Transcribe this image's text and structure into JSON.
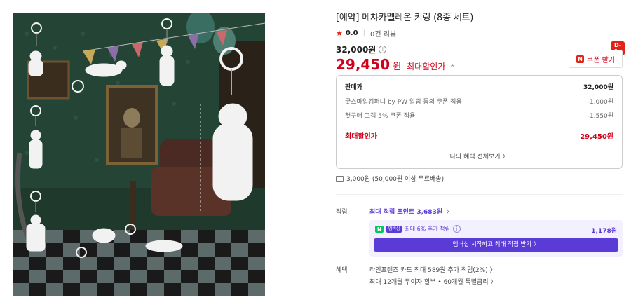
{
  "product": {
    "title": "[예약] 메챠카멜레온 키링 (8종 세트)",
    "rating_star": "★",
    "rating": "0.0",
    "reviews": "0건 리뷰"
  },
  "price": {
    "original": "32,000원",
    "sale_number": "29,450",
    "sale_unit": "원",
    "sale_label": "최대할인가",
    "sale_toggle": "⌃",
    "dday_badge": "D-1",
    "coupon_label": "쿠폰 받기",
    "coupon_icon_text": "N"
  },
  "breakdown": {
    "header_label": "판매가",
    "header_value": "32,000원",
    "rows": [
      {
        "label": "굿스마일컴퍼니 by PW 알림 동의 쿠폰 적용",
        "value": "-1,000원"
      },
      {
        "label": "첫구매 고객 5% 쿠폰 적용",
        "value": "-1,550원"
      }
    ],
    "best_label": "최대할인가",
    "best_value": "29,450원",
    "more_link": "나의 혜택 전체보기 〉"
  },
  "shipping": {
    "text": "3,000원 (50,000원 이상 무료배송)"
  },
  "points": {
    "label": "적립",
    "max_text": "최대 적립 포인트 3,683원",
    "chev": "〉",
    "membership_text": "최대 6% 추가 적립",
    "membership_badge_n": "N",
    "membership_badge_plus": "멤버십",
    "membership_value": "1,178원",
    "membership_button": "멤버십 시작하고 최대 적립 받기 〉"
  },
  "benefits": {
    "label": "혜택",
    "line1": "라인프렌즈 카드 최대 589원 추가 적립(2%) 〉",
    "line2": "최대 12개월 무이자 할부 • 60개월 특별금리 〉"
  },
  "colors": {
    "accent_red": "#d0021b",
    "accent_purple": "#5b3bd6",
    "naver_green": "#03c75a"
  }
}
